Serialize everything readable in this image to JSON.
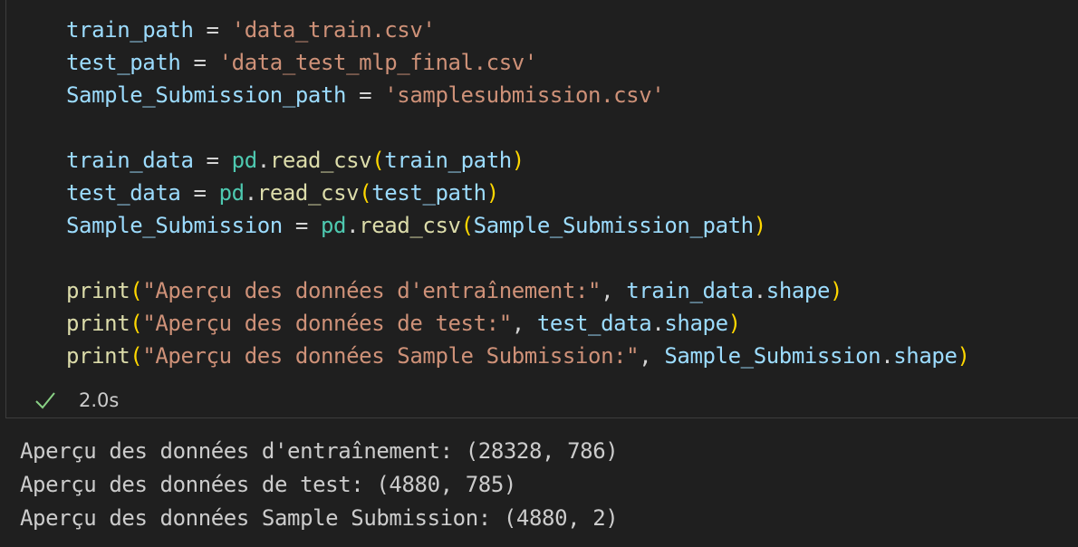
{
  "code": {
    "l1": {
      "var": "train_path",
      "op": " = ",
      "str": "'data_train.csv'"
    },
    "l2": {
      "var": "test_path",
      "op": " = ",
      "str": "'data_test_mlp_final.csv'"
    },
    "l3": {
      "var": "Sample_Submission_path",
      "op": " = ",
      "str": "'samplesubmission.csv'"
    },
    "l4": {
      "var": "train_data",
      "op": " = ",
      "mod": "pd",
      "dot": ".",
      "fn": "read_csv",
      "open": "(",
      "arg": "train_path",
      "close": ")"
    },
    "l5": {
      "var": "test_data",
      "op": " = ",
      "mod": "pd",
      "dot": ".",
      "fn": "read_csv",
      "open": "(",
      "arg": "test_path",
      "close": ")"
    },
    "l6": {
      "var": "Sample_Submission",
      "op": " = ",
      "mod": "pd",
      "dot": ".",
      "fn": "read_csv",
      "open": "(",
      "arg": "Sample_Submission_path",
      "close": ")"
    },
    "l7": {
      "fn": "print",
      "open": "(",
      "str": "\"Aperçu des données d'entraînement:\"",
      "comma": ", ",
      "obj": "train_data",
      "dot": ".",
      "attr": "shape",
      "close": ")"
    },
    "l8": {
      "fn": "print",
      "open": "(",
      "str": "\"Aperçu des données de test:\"",
      "comma": ", ",
      "obj": "test_data",
      "dot": ".",
      "attr": "shape",
      "close": ")"
    },
    "l9": {
      "fn": "print",
      "open": "(",
      "str": "\"Aperçu des données Sample Submission:\"",
      "comma": ", ",
      "obj": "Sample_Submission",
      "dot": ".",
      "attr": "shape",
      "close": ")"
    }
  },
  "status": {
    "icon": "check-icon",
    "duration": "2.0s",
    "color": "#89d185"
  },
  "output": {
    "lines": [
      "Aperçu des données d'entraînement: (28328, 786)",
      "Aperçu des données de test: (4880, 785)",
      "Aperçu des données Sample Submission: (4880, 2)"
    ]
  }
}
